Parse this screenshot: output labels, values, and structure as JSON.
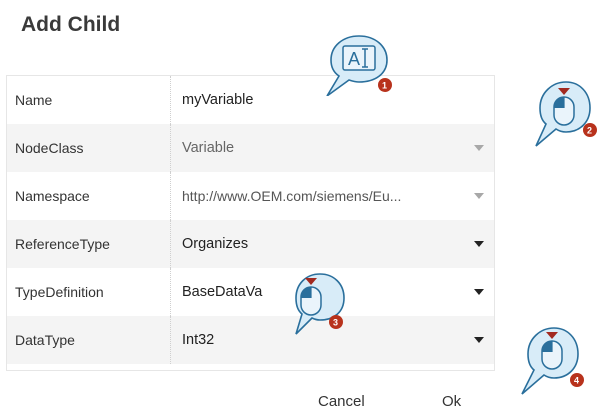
{
  "dialog": {
    "title": "Add Child",
    "fields": [
      {
        "label": "Name",
        "value": "myVariable"
      },
      {
        "label": "NodeClass",
        "value": "Variable"
      },
      {
        "label": "Namespace",
        "value": "http://www.OEM.com/siemens/Eu..."
      },
      {
        "label": "ReferenceType",
        "value": "Organizes"
      },
      {
        "label": "TypeDefinition",
        "value": "BaseDataVa          pe"
      },
      {
        "label": "DataType",
        "value": "Int32"
      }
    ],
    "cancel_label": "Cancel",
    "ok_label": "Ok"
  },
  "callouts": [
    {
      "icon": "text-input-icon",
      "number": "1"
    },
    {
      "icon": "mouse-click-icon",
      "number": "2"
    },
    {
      "icon": "mouse-click-icon",
      "number": "3"
    },
    {
      "icon": "mouse-click-icon",
      "number": "4"
    }
  ],
  "colors": {
    "callout_fill": "#d8ecf8",
    "callout_stroke": "#2a6f9c",
    "badge": "#b8321c",
    "alt_row": "#f4f4f4"
  }
}
